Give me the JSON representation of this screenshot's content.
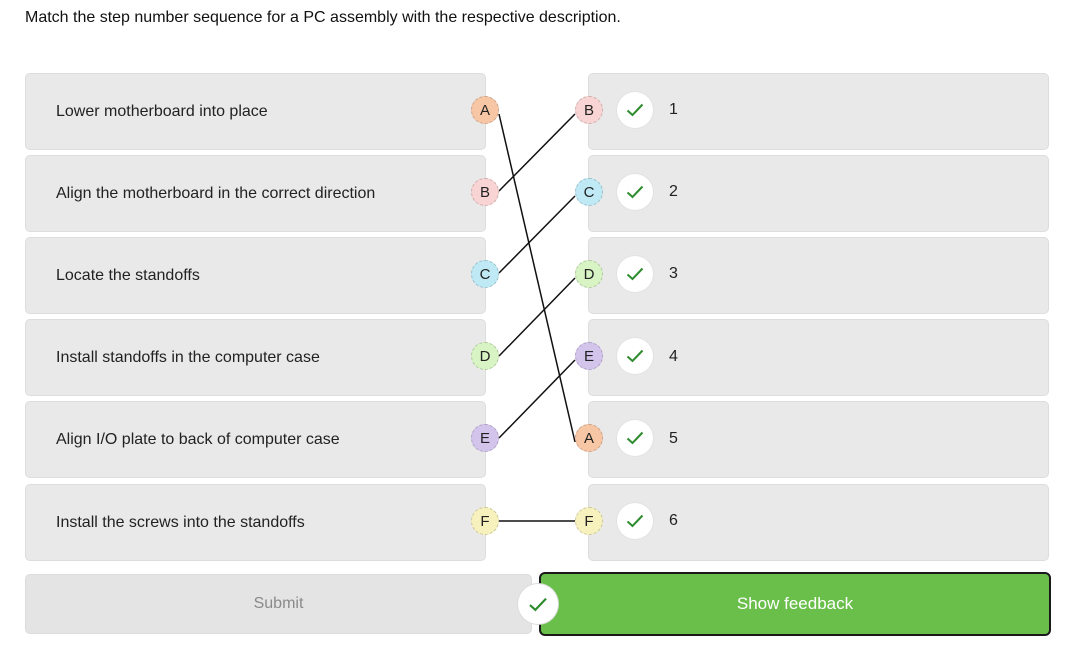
{
  "prompt": "Match the step number sequence for a PC assembly with the respective description.",
  "colors": {
    "A": "#f7c6a5",
    "B": "#f8d4d4",
    "C": "#bfe9f4",
    "D": "#d8f3c4",
    "E": "#d3c4ec",
    "F": "#f7f2bd",
    "check": "#2e8b2e",
    "button_green": "#6abf4b"
  },
  "left_items": [
    {
      "label": "Lower motherboard into place",
      "letter": "A"
    },
    {
      "label": "Align the motherboard in the correct direction",
      "letter": "B"
    },
    {
      "label": "Locate the standoffs",
      "letter": "C"
    },
    {
      "label": "Install standoffs in the computer case",
      "letter": "D"
    },
    {
      "label": "Align I/O plate to back of computer case",
      "letter": "E"
    },
    {
      "label": "Install the screws into the standoffs",
      "letter": "F"
    }
  ],
  "right_items": [
    {
      "letter": "B",
      "number": "1",
      "status": "correct"
    },
    {
      "letter": "C",
      "number": "2",
      "status": "correct"
    },
    {
      "letter": "D",
      "number": "3",
      "status": "correct"
    },
    {
      "letter": "E",
      "number": "4",
      "status": "correct"
    },
    {
      "letter": "A",
      "number": "5",
      "status": "correct"
    },
    {
      "letter": "F",
      "number": "6",
      "status": "correct"
    }
  ],
  "buttons": {
    "submit": "Submit",
    "show_feedback": "Show feedback"
  }
}
